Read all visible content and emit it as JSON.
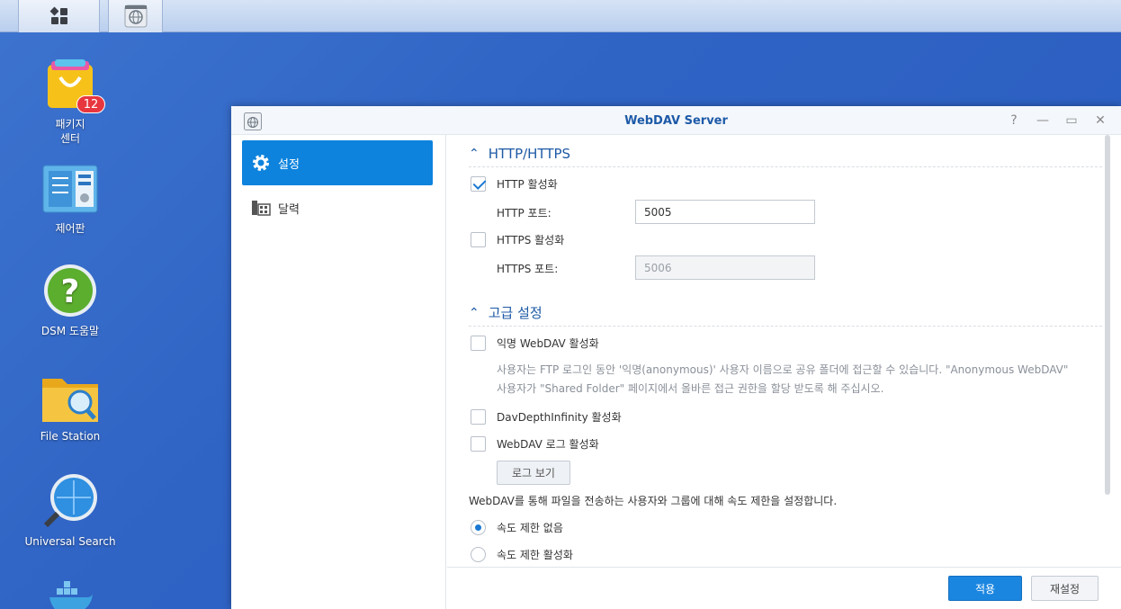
{
  "desktop": {
    "icons": [
      {
        "label": "패키지\n센터",
        "badge": "12"
      },
      {
        "label": "제어판"
      },
      {
        "label": "DSM 도움말"
      },
      {
        "label": "File Station"
      },
      {
        "label": "Universal Search"
      }
    ]
  },
  "window": {
    "title": "WebDAV Server",
    "controls": {
      "help": "?",
      "minimize": "—",
      "maximize": "▭",
      "close": "✕"
    }
  },
  "sidebar": {
    "items": [
      {
        "label": "설정"
      },
      {
        "label": "달력"
      }
    ]
  },
  "content": {
    "section_http": {
      "title": "HTTP/HTTPS"
    },
    "http_enable": {
      "label": "HTTP 활성화",
      "checked": true
    },
    "http_port": {
      "label": "HTTP 포트:",
      "value": "5005"
    },
    "https_enable": {
      "label": "HTTPS 활성화",
      "checked": false
    },
    "https_port": {
      "label": "HTTPS 포트:",
      "value": "5006"
    },
    "section_advanced": {
      "title": "고급 설정"
    },
    "anon_enable": {
      "label": "익명 WebDAV 활성화",
      "checked": false
    },
    "anon_hint": "사용자는 FTP 로그인 동안 '익명(anonymous)' 사용자 이름으로 공유 폴더에 접근할 수 있습니다. \"Anonymous WebDAV\" 사용자가 \"Shared Folder\" 페이지에서 올바른 접근 권한을 할당 받도록 해 주십시오.",
    "depth_enable": {
      "label": "DavDepthInfinity 활성화",
      "checked": false
    },
    "log_enable": {
      "label": "WebDAV 로그 활성화",
      "checked": false
    },
    "log_view_button": "로그 보기",
    "speed_text": "WebDAV를 통해 파일을 전송하는 사용자와 그룹에 대해 속도 제한을 설정합니다.",
    "speed_none": {
      "label": "속도 제한 없음",
      "checked": true
    },
    "speed_enable": {
      "label": "속도 제한 활성화",
      "checked": false
    }
  },
  "footer": {
    "apply": "적용",
    "reset": "재설정"
  },
  "colors": {
    "accent": "#0d83dd",
    "section_title": "#1d5aa5",
    "desktop_bg": "#2f63c4"
  }
}
